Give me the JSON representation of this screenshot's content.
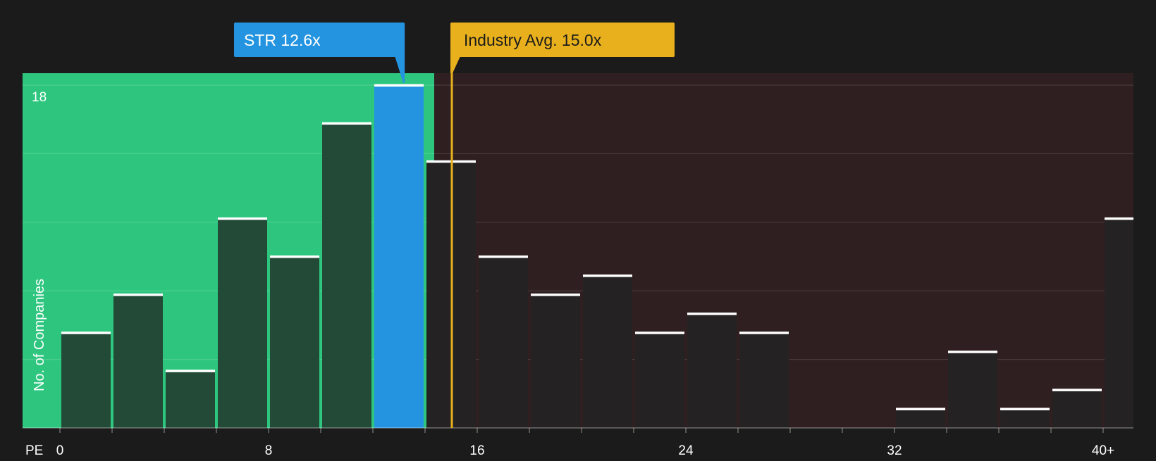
{
  "chart_data": {
    "type": "bar",
    "x_axis_label": "PE",
    "y_axis_label": "No. of Companies",
    "y_tick_label": "18",
    "ylim": [
      0,
      18
    ],
    "bin_width": 2,
    "x_ticks": [
      "0",
      "8",
      "16",
      "24",
      "32",
      "40+"
    ],
    "bins": [
      {
        "start": 0,
        "count": 5
      },
      {
        "start": 2,
        "count": 7
      },
      {
        "start": 4,
        "count": 3
      },
      {
        "start": 6,
        "count": 11
      },
      {
        "start": 8,
        "count": 9
      },
      {
        "start": 10,
        "count": 16
      },
      {
        "start": 12,
        "count": 18
      },
      {
        "start": 14,
        "count": 14
      },
      {
        "start": 16,
        "count": 9
      },
      {
        "start": 18,
        "count": 7
      },
      {
        "start": 20,
        "count": 8
      },
      {
        "start": 22,
        "count": 5
      },
      {
        "start": 24,
        "count": 6
      },
      {
        "start": 26,
        "count": 5
      },
      {
        "start": 28,
        "count": 0
      },
      {
        "start": 30,
        "count": 0
      },
      {
        "start": 32,
        "count": 1
      },
      {
        "start": 34,
        "count": 4
      },
      {
        "start": 36,
        "count": 1
      },
      {
        "start": 38,
        "count": 2
      },
      {
        "start": 40,
        "count": 11
      }
    ],
    "company": {
      "ticker": "STR",
      "pe": 12.6,
      "label": "STR 12.6x"
    },
    "industry_avg": {
      "pe": 15.0,
      "label": "Industry Avg. 15.0x"
    },
    "grid": true,
    "colors": {
      "background": "#1b1b1b",
      "undervalued_zone": "#2ec67f",
      "overvalued_zone": "#2f1f20",
      "bar_in_green": "#234a37",
      "bar_in_red": "#252223",
      "bar_company": "#2494e0",
      "company_callout": "#2494e0",
      "industry_callout": "#e8b01c",
      "bar_cap": "#ffffff",
      "text": "#ffffff",
      "callout_industry_text": "#1b1b1b"
    }
  }
}
